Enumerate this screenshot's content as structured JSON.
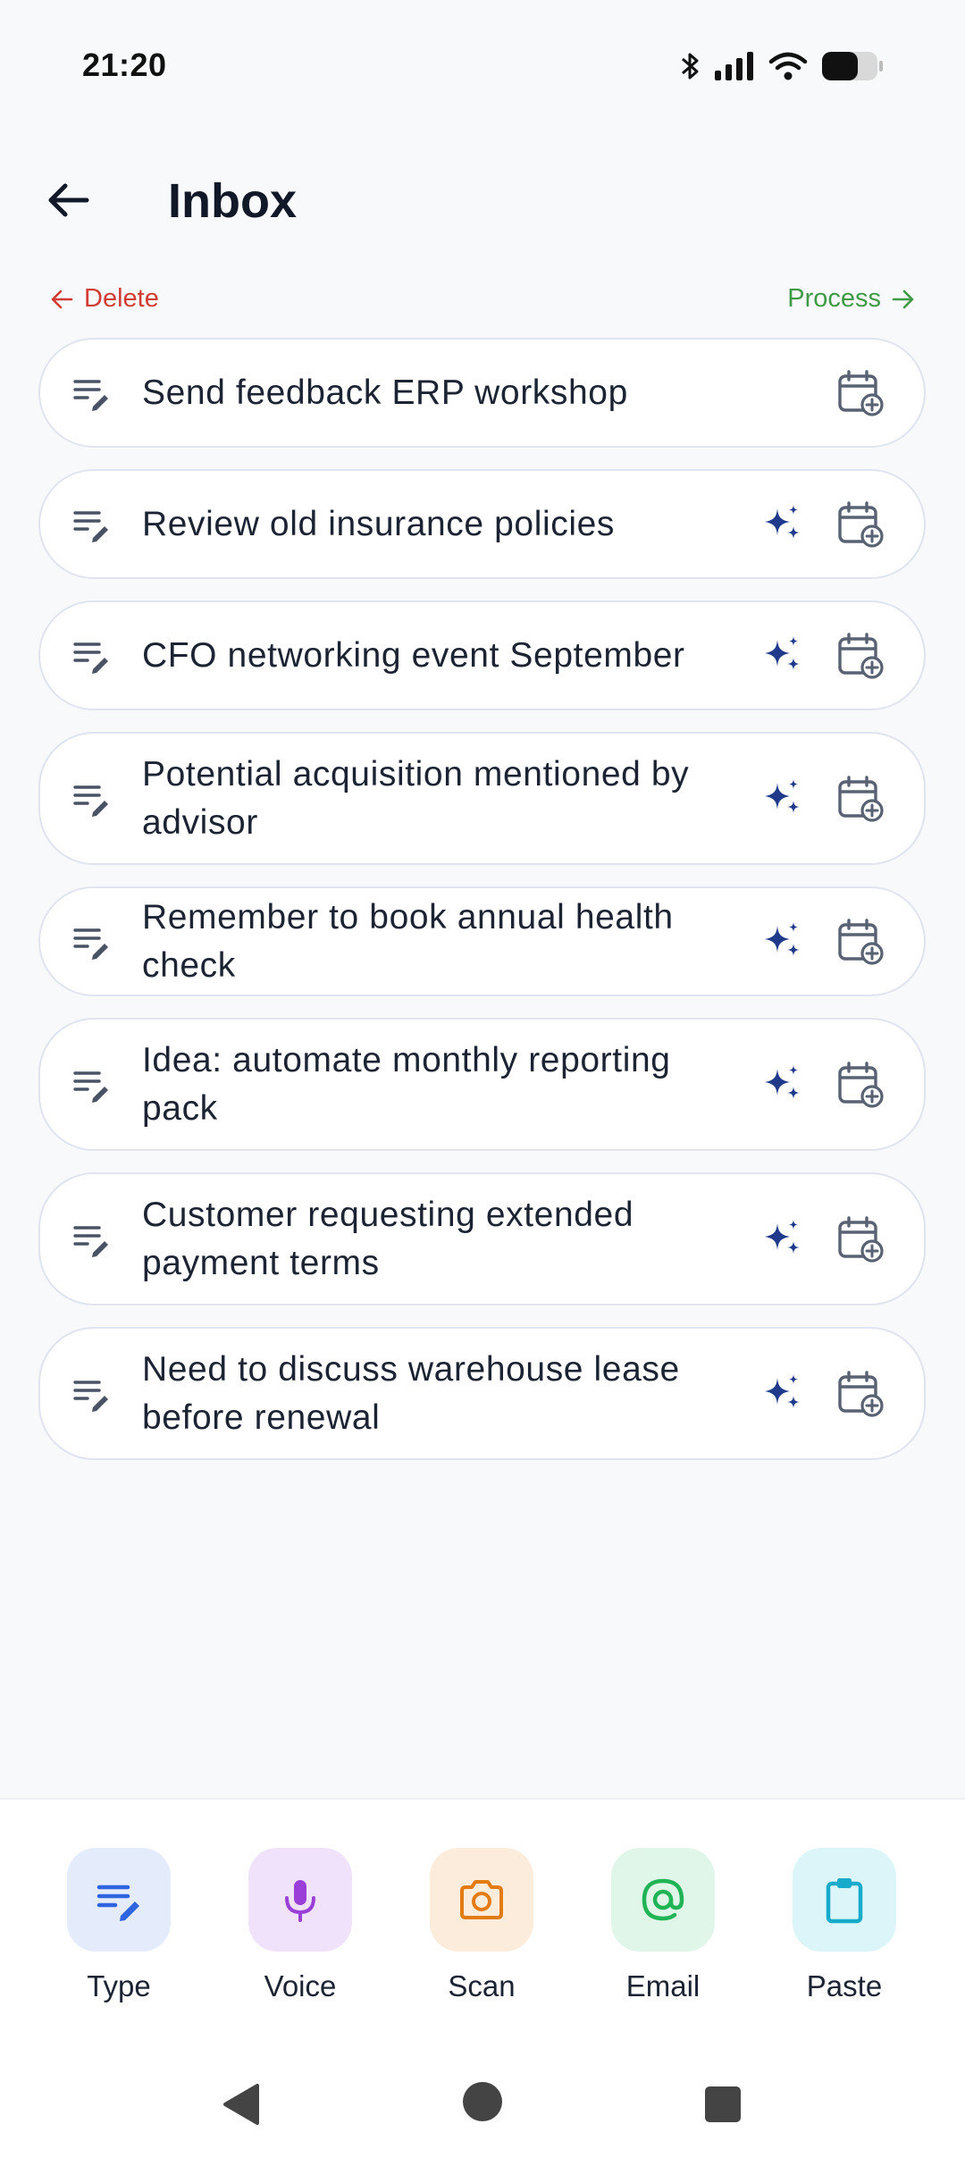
{
  "status_bar": {
    "time": "21:20",
    "icons": [
      "bluetooth-icon",
      "signal-icon",
      "wifi-icon",
      "battery-icon"
    ]
  },
  "header": {
    "back_icon": "arrow-left-icon",
    "title": "Inbox"
  },
  "actions": {
    "delete_label": "Delete",
    "process_label": "Process"
  },
  "items": [
    {
      "text": "Send feedback ERP workshop",
      "has_sparkle": false
    },
    {
      "text": "Review old insurance policies",
      "has_sparkle": true
    },
    {
      "text": "CFO networking event September",
      "has_sparkle": true
    },
    {
      "text": "Potential acquisition mentioned by advisor",
      "has_sparkle": true
    },
    {
      "text": "Remember to book annual health check",
      "has_sparkle": true
    },
    {
      "text": "Idea: automate monthly reporting pack",
      "has_sparkle": true
    },
    {
      "text": "Customer requesting extended payment terms",
      "has_sparkle": true
    },
    {
      "text": "Need to discuss warehouse lease before renewal",
      "has_sparkle": true
    }
  ],
  "capture": [
    {
      "label": "Type",
      "icon": "type-edit-icon",
      "bg": "#e4ebfb",
      "color": "#2f64e0"
    },
    {
      "label": "Voice",
      "icon": "microphone-icon",
      "bg": "#f1e2fb",
      "color": "#9b3fd9"
    },
    {
      "label": "Scan",
      "icon": "camera-icon",
      "bg": "#fcecdc",
      "color": "#e27c12"
    },
    {
      "label": "Email",
      "icon": "at-sign-icon",
      "bg": "#e0f6e8",
      "color": "#21b457"
    },
    {
      "label": "Paste",
      "icon": "clipboard-icon",
      "bg": "#dcf5f8",
      "color": "#16aacb"
    }
  ],
  "colors": {
    "delete": "#d23a34",
    "process": "#3f9a47",
    "sparkle": "#1f3a8a",
    "calendar": "#596273",
    "note_icon": "#4a5366"
  }
}
